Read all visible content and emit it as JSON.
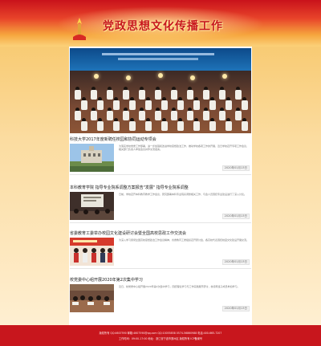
{
  "header": {
    "title": "党政思想文化传播工作"
  },
  "hero": {
    "alt_caption": ""
  },
  "news": [
    {
      "title": "科技大学2017年度新聘任校园和协同运动专项会",
      "summary": "为落实学校党委工作部署，进一步加强和改进学校思想政治工作，推动学校各项工作的开展，近日学校召开专项工作会议，相关部门负责人参加会议并作交流发言。",
      "date": "2020年01月13日"
    },
    {
      "title": "本科教育学院 指导专业院系调整方案报告\"发展\" 指导专业院系调整",
      "summary": "日前，学校召开本科教育教学工作会议，研究部署本科专业院系调整相关工作，与会人员围绕专业建设进行了深入讨论。",
      "date": "2020年01月13日"
    },
    {
      "title": "省委教育工委举办校园文化建设研讨会暨全国高校思政工作交流会",
      "summary": "为深入学习贯彻全国高校思想政治工作会议精神，省委教育工委组织召开研讨会，各高校代表围绕校园文化建设开展交流。",
      "date": "2020年01月13日"
    },
    {
      "title": "校党委中心组开展2020年第2次集中学习",
      "summary": "近日，校党委中心组开展2020年第2次集中学习，围绕理论学习与工作实践展开研讨，校领导班子成员参加学习。",
      "date": "2020年01月13日"
    }
  ],
  "footer": {
    "line1": "版权所有 QQ:4607590 邮箱:4607590@qq.com QQ:10055858 0574-56860988 电话:400-665-7207",
    "line2": "工作时间：09:00-17:00 地址：浙江省宁波市鄞州区 版权所有 ICP备案号"
  },
  "colors": {
    "brand_red": "#c8161d",
    "title_red": "#c8171e",
    "accent_gold": "#f6a63e"
  }
}
